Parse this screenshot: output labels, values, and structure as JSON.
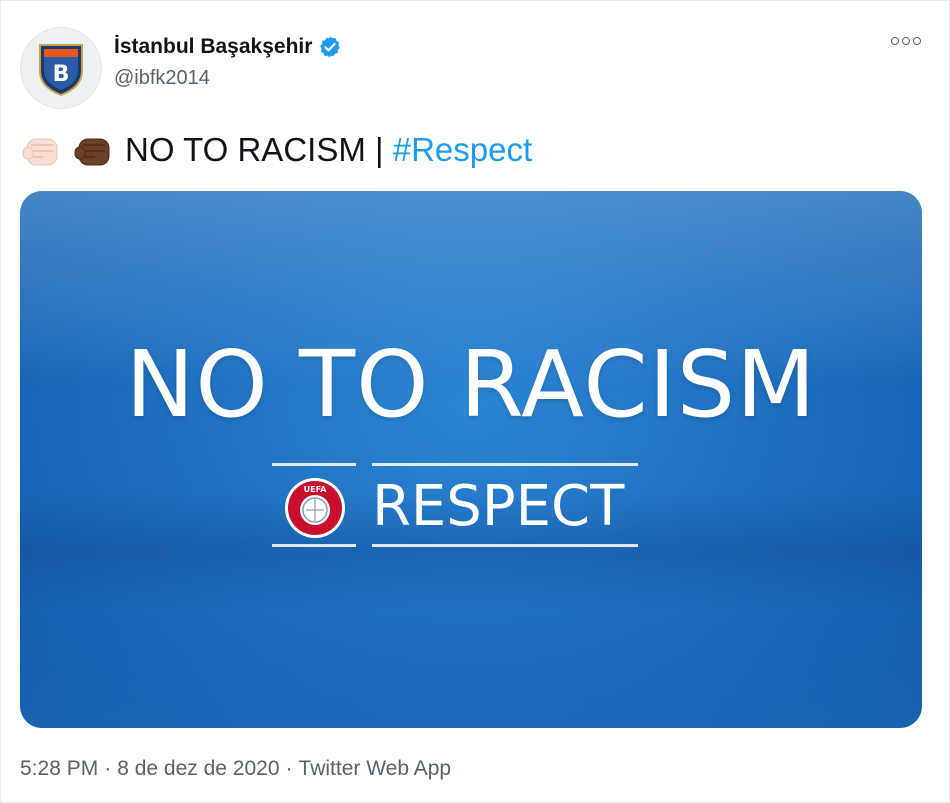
{
  "account": {
    "name": "İstanbul Başakşehir",
    "handle": "@ibfk2014",
    "avatar_letter": "B",
    "verified": true
  },
  "tweet": {
    "emojis": [
      "raised-fist-light-skin",
      "raised-fist-dark-skin"
    ],
    "text": "NO TO RACISM | ",
    "hashtag": "#Respect"
  },
  "media": {
    "headline": "NO TO RACISM",
    "subline": "RESPECT",
    "logo_text": "UEFA"
  },
  "meta": {
    "time": "5:28 PM",
    "date": "8 de dez de 2020",
    "source": "Twitter Web App",
    "separator": "·"
  },
  "colors": {
    "accent": "#1d9bf0",
    "verified": "#1d9bf0",
    "media_blue": "#1f6fc0",
    "secondary_text": "#536471"
  }
}
